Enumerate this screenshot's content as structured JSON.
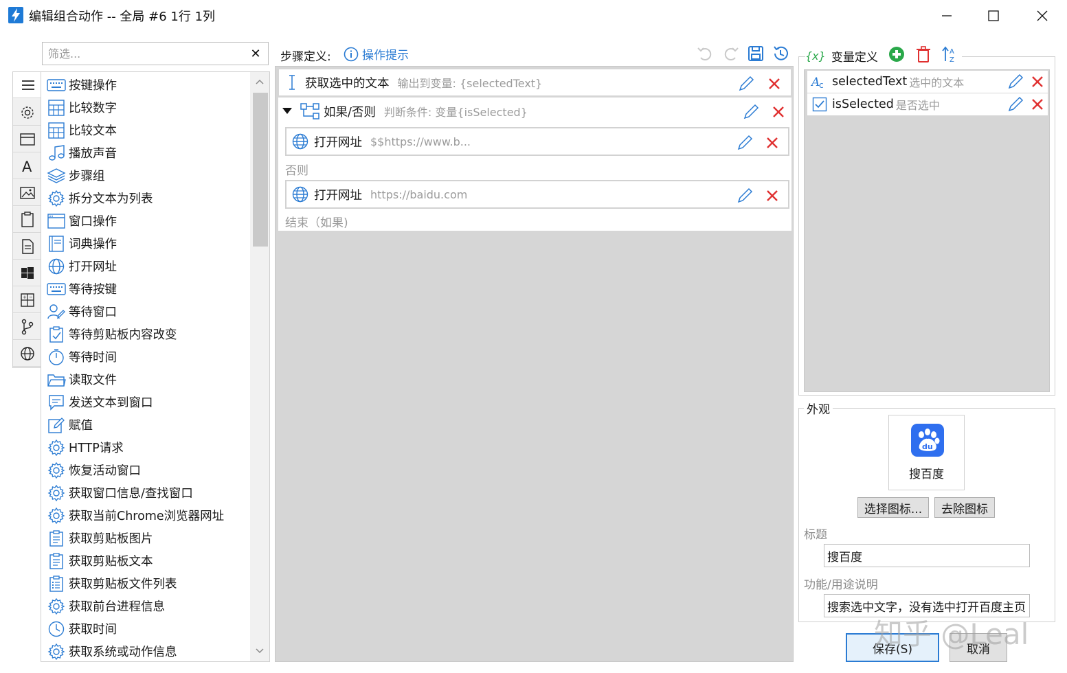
{
  "window": {
    "title": "编辑组合动作 -- 全局 #6 1行 1列"
  },
  "filter": {
    "placeholder": "筛选...",
    "clear": "✕"
  },
  "tabs": [
    "menu-icon",
    "gear-icon",
    "window-icon",
    "font-icon",
    "image-icon",
    "clipboard-icon",
    "document-icon",
    "windows-logo-icon",
    "calculator-icon",
    "branch-icon",
    "globe-icon"
  ],
  "actions": [
    {
      "label": "按键操作",
      "icon": "keyboard-icon"
    },
    {
      "label": "比较数字",
      "icon": "grid-icon"
    },
    {
      "label": "比较文本",
      "icon": "grid-icon"
    },
    {
      "label": "播放声音",
      "icon": "music-icon"
    },
    {
      "label": "步骤组",
      "icon": "layers-icon"
    },
    {
      "label": "拆分文本为列表",
      "icon": "gear-icon"
    },
    {
      "label": "窗口操作",
      "icon": "window-icon"
    },
    {
      "label": "词典操作",
      "icon": "book-icon"
    },
    {
      "label": "打开网址",
      "icon": "globe-icon"
    },
    {
      "label": "等待按键",
      "icon": "keyboard-icon"
    },
    {
      "label": "等待窗口",
      "icon": "user-edit-icon"
    },
    {
      "label": "等待剪贴板内容改变",
      "icon": "clipboard-check-icon"
    },
    {
      "label": "等待时间",
      "icon": "stopwatch-icon"
    },
    {
      "label": "读取文件",
      "icon": "folder-icon"
    },
    {
      "label": "发送文本到窗口",
      "icon": "message-icon"
    },
    {
      "label": "赋值",
      "icon": "edit-icon"
    },
    {
      "label": "HTTP请求",
      "icon": "gear-icon"
    },
    {
      "label": "恢复活动窗口",
      "icon": "gear-icon"
    },
    {
      "label": "获取窗口信息/查找窗口",
      "icon": "gear-icon"
    },
    {
      "label": "获取当前Chrome浏览器网址",
      "icon": "gear-icon"
    },
    {
      "label": "获取剪贴板图片",
      "icon": "clipboard-doc-icon"
    },
    {
      "label": "获取剪贴板文本",
      "icon": "clipboard-doc-icon"
    },
    {
      "label": "获取剪贴板文件列表",
      "icon": "clipboard-list-icon"
    },
    {
      "label": "获取前台进程信息",
      "icon": "gear-icon"
    },
    {
      "label": "获取时间",
      "icon": "clock-icon"
    },
    {
      "label": "获取系统或动作信息",
      "icon": "gear-icon"
    }
  ],
  "steps": {
    "label": "步骤定义:",
    "hint": "操作提示",
    "items": [
      {
        "label": "获取选中的文本",
        "detail": "输出到变量: {selectedText}"
      },
      {
        "label": "如果/否则",
        "detail": "判断条件: 变量{isSelected}"
      },
      {
        "label": "打开网址",
        "detail": "$$https://www.b..."
      },
      {
        "label": "打开网址",
        "detail": "https://baidu.com"
      }
    ],
    "else_label": "否则",
    "end_label": "结束（如果)"
  },
  "variables": {
    "header": "变量定义",
    "header_icon_text": "{x}",
    "items": [
      {
        "name": "selectedText",
        "desc": "选中的文本"
      },
      {
        "name": "isSelected",
        "desc": "是否选中"
      }
    ]
  },
  "appearance": {
    "legend": "外观",
    "icon_caption": "搜百度",
    "choose_icon": "选择图标...",
    "remove_icon": "去除图标",
    "title_label": "标题",
    "title_value": "搜百度",
    "desc_label": "功能/用途说明",
    "desc_value": "搜索选中文字，没有选中打开百度主页"
  },
  "buttons": {
    "save": "保存(S)",
    "cancel": "取消"
  },
  "watermark": "知乎 @Leal",
  "colors": {
    "accent": "#2a7bd3",
    "delete": "#e03030",
    "add": "#2aa84a",
    "panel_grey": "#d6d6d6",
    "baidu_blue": "#2f6fef"
  }
}
